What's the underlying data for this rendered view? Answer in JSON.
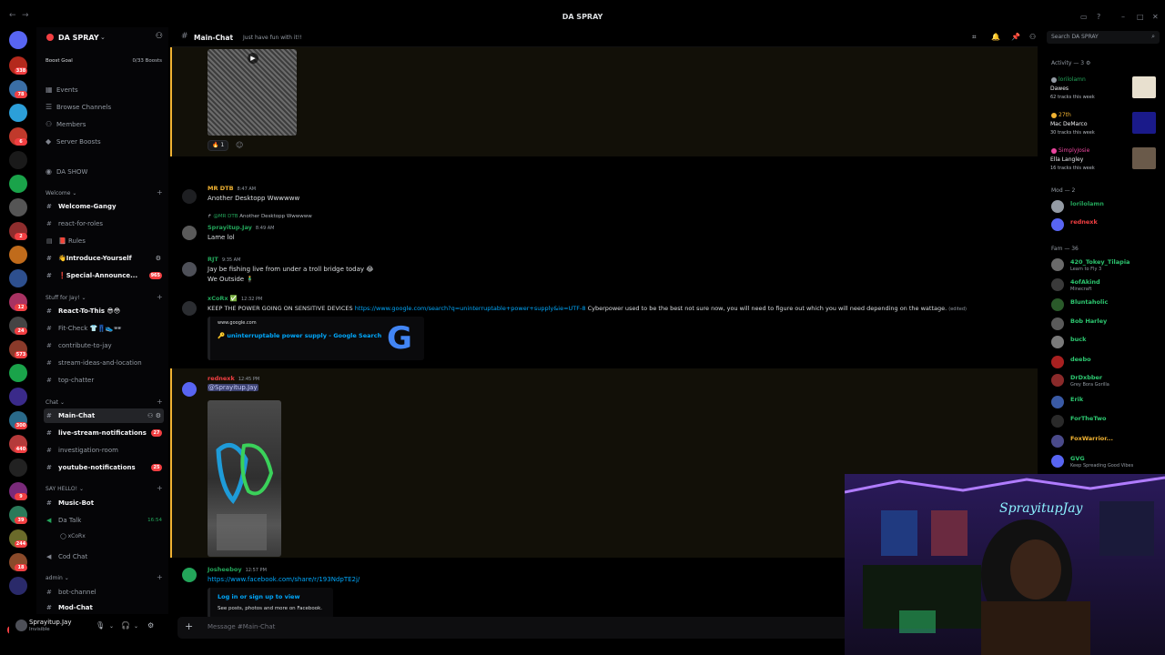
{
  "window": {
    "title": "DA SPRAY",
    "back": "←",
    "forward": "→"
  },
  "server": {
    "name": "DA SPRAY",
    "boost_goal": "Boost Goal",
    "boost_count": "0/33 Boosts"
  },
  "sidebar": {
    "items": [
      {
        "label": "Events",
        "icon": "calendar-icon"
      },
      {
        "label": "Browse Channels",
        "icon": "browse-icon"
      },
      {
        "label": "Members",
        "icon": "members-icon"
      },
      {
        "label": "Server Boosts",
        "icon": "boost-icon"
      },
      {
        "label": "DA SHOW",
        "icon": "show-icon"
      }
    ],
    "categories": {
      "welcome": "Welcome",
      "stuff": "Stuff for Jay!",
      "chat": "Chat",
      "sayhello": "SAY HELLO!",
      "admin": "admin"
    },
    "channels": {
      "welcome_gangy": "Welcome-Gangy",
      "react_for_roles": "react-for-roles",
      "rules": "Rules",
      "introduce": "Introduce-Yourself",
      "special": "Special-Announce...",
      "special_count": "965",
      "react_to_this": "React-To-This",
      "fit_check": "Fit-Check",
      "contribute": "contribute-to-jay",
      "stream_ideas": "stream-ideas-and-location",
      "top_chatter": "top-chatter",
      "main_chat": "Main-Chat",
      "live_stream": "live-stream-notifications",
      "live_count": "27",
      "investigation": "investigation-room",
      "youtube": "youtube-notifications",
      "youtube_count": "25",
      "music_bot": "Music-Bot",
      "da_talk": "Da Talk",
      "da_talk_time": "16:54",
      "voice_user": "xCoRx",
      "cod_chat": "Cod Chat",
      "bot_channel": "bot-channel",
      "mod_chat": "Mod-Chat"
    }
  },
  "user": {
    "name": "Sprayitup.Jay",
    "status": "Invisible"
  },
  "channel": {
    "name": "Main-Chat",
    "topic": "Just have fun with it!!",
    "search_placeholder": "Search DA SPRAY"
  },
  "messages": {
    "reaction_count": "1",
    "m1": {
      "author": "MR DTB",
      "time": "8:47 AM",
      "text": "Another Desktopp Wwwwww"
    },
    "m2": {
      "reply_author": "@MR DTB",
      "reply_text": "Another Desktopp Wwwwww",
      "author": "Sprayitup.Jay",
      "time": "8:49 AM",
      "text": "Lame lol"
    },
    "m3": {
      "author": "RJT",
      "time": "9:35 AM",
      "text": "Jay be fishing live from under a troll bridge today 😂",
      "text2": "We Outside 🧍‍♂️"
    },
    "m4": {
      "author": "xCoRx",
      "time": "12:32 PM",
      "text_a": "KEEP THE POWER GOING ON SENSITIVE DEVICES",
      "link": "https://www.google.com/search?q=uninterruptable+power+supply&ie=UTF-8",
      "text_b": "Cyberpower used to be the best not sure now, you will need to figure out which you will need depending on the wattage.",
      "edited": "(edited)",
      "embed_provider": "www.google.com",
      "embed_title": "🔑 uninterruptable power supply - Google Search",
      "embed_logo": "G"
    },
    "m5": {
      "author": "rednexk",
      "time": "12:45 PM",
      "mention": "@Sprayitup.Jay"
    },
    "m6": {
      "author": "Josheeboy",
      "time": "12:57 PM",
      "link": "https://www.facebook.com/share/r/193NdpTE2j/",
      "embed_title": "Log in or sign up to view",
      "embed_desc": "See posts, photos and more on Facebook."
    },
    "composer_placeholder": "Message #Main-Chat"
  },
  "members": {
    "activity_header": "Activity — 3",
    "activity": [
      {
        "name": "lorilolamn",
        "artist": "Dawes",
        "tracks": "62 tracks this week",
        "color": "#23a55a"
      },
      {
        "name": "27th",
        "artist": "Mac DeMarco",
        "tracks": "30 tracks this week",
        "color": "#f0b232"
      },
      {
        "name": "SimplyJosie",
        "artist": "Ella Langley",
        "tracks": "16 tracks this week",
        "color": "#eb459e"
      }
    ],
    "mod_header": "Mod — 2",
    "mods": [
      {
        "name": "lorilolamn",
        "color": "#23a55a"
      },
      {
        "name": "rednexk",
        "color": "#f23f42"
      }
    ],
    "fam_header": "Fam — 36",
    "fam": [
      {
        "name": "420_Tokey_Tilapia",
        "status": "Learn to Fly 3",
        "color": "#2dc770"
      },
      {
        "name": "4ofAkind",
        "status": "Minecraft",
        "color": "#2dc770"
      },
      {
        "name": "Bluntaholic",
        "status": "",
        "color": "#2dc770"
      },
      {
        "name": "Bob Harley",
        "status": "",
        "color": "#2dc770"
      },
      {
        "name": "buck",
        "status": "",
        "color": "#2dc770"
      },
      {
        "name": "deebo",
        "status": "",
        "color": "#2dc770"
      },
      {
        "name": "DrDxbber",
        "status": "Grey Bora Gorilla",
        "color": "#2dc770"
      },
      {
        "name": "Erik",
        "status": "",
        "color": "#2dc770"
      },
      {
        "name": "ForTheTwo",
        "status": "",
        "color": "#2dc770"
      },
      {
        "name": "FoxWarrior...",
        "status": "",
        "color": "#f0b232"
      },
      {
        "name": "GVG",
        "status": "Keep Spreading Good Vibes",
        "color": "#2dc770"
      }
    ]
  },
  "colors": {
    "accent_green": "#23a55a",
    "mention_red": "#f23f42",
    "link_blue": "#00a8fc",
    "highlight_gold": "#f0b232"
  }
}
